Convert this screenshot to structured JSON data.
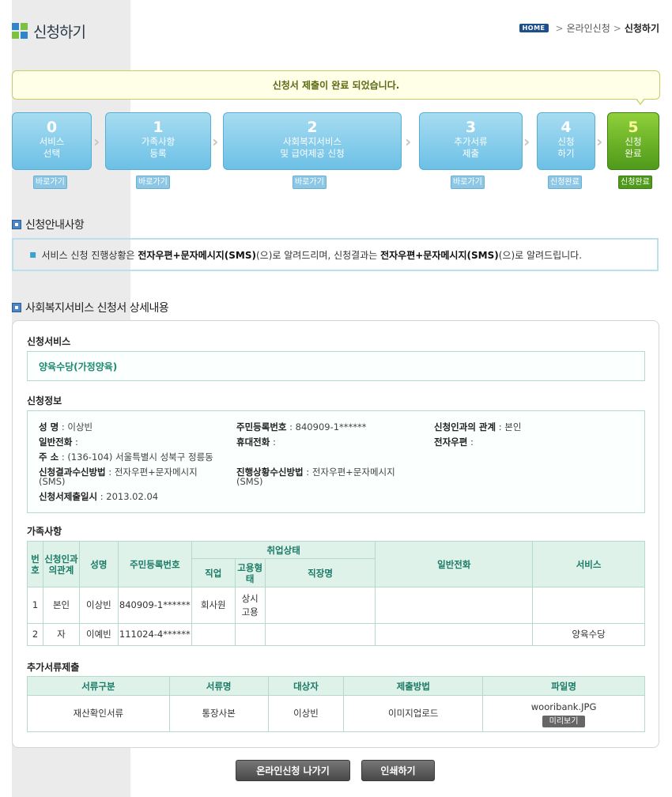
{
  "page": {
    "title": "신청하기"
  },
  "breadcrumb": {
    "home": "HOME",
    "items": [
      "온라인신청",
      "신청하기"
    ]
  },
  "notice": {
    "text": "신청서 제출이 완료 되었습니다."
  },
  "steps": [
    {
      "num": "0",
      "line1": "서비스",
      "line2": "선택",
      "badge": "바로가기"
    },
    {
      "num": "1",
      "line1": "가족사항",
      "line2": "등록",
      "badge": "바로가기"
    },
    {
      "num": "2",
      "line1": "사회복지서비스",
      "line2": "및 급여제공 신청",
      "badge": "바로가기"
    },
    {
      "num": "3",
      "line1": "추가서류",
      "line2": "제출",
      "badge": "바로가기"
    },
    {
      "num": "4",
      "line1": "신청",
      "line2": "하기",
      "badge": "신청완료"
    },
    {
      "num": "5",
      "line1": "신청",
      "line2": "완료",
      "badge": "신청완료"
    }
  ],
  "guide": {
    "heading": "신청안내사항",
    "text_a": "서비스 신청 진행상황은 ",
    "bold_a": "전자우편+문자메시지(SMS)",
    "text_b": "(으)로 알려드리며, 신청결과는 ",
    "bold_b": "전자우편+문자메시지(SMS)",
    "text_c": "(으)로 알려드립니다."
  },
  "detail": {
    "heading": "사회복지서비스 신청서 상세내용",
    "service_label": "신청서비스",
    "service_value": "양육수당(가정양육)",
    "info_label": "신청정보",
    "info": {
      "name_label": "성 명",
      "name": "이상빈",
      "rrn_label": "주민등록번호",
      "rrn": "840909-1******",
      "relation_label": "신청인과의 관계",
      "relation": "본인",
      "phone_label": "일반전화",
      "phone": "",
      "mobile_label": "휴대전화",
      "mobile": "",
      "email_label": "전자우편",
      "email": "",
      "address_label": "주 소",
      "address": "(136-104) 서울특별시 성북구 정릉동",
      "result_method_label": "신청결과수신방법",
      "result_method_1": "전자우편+문자메시지",
      "result_method_2": "(SMS)",
      "progress_method_label": "진행상황수신방법",
      "progress_method_1": "전자우편+문자메시지",
      "progress_method_2": "(SMS)",
      "submit_date_label": "신청서제출일시",
      "submit_date": "2013.02.04"
    },
    "family_label": "가족사항",
    "family_headers": {
      "no": "번호",
      "relation": "신청인과의관계",
      "name": "성명",
      "rrn": "주민등록번호",
      "employment": "취업상태",
      "job": "직업",
      "emp_type": "고용형태",
      "workplace": "직장명",
      "phone": "일반전화",
      "service": "서비스"
    },
    "family_rows": [
      {
        "no": "1",
        "relation": "본인",
        "name": "이상빈",
        "rrn": "840909-1******",
        "job": "회사원",
        "emp_type_1": "상시",
        "emp_type_2": "고용",
        "workplace": "",
        "phone": "",
        "service": ""
      },
      {
        "no": "2",
        "relation": "자",
        "name": "이예빈",
        "rrn": "111024-4******",
        "job": "",
        "emp_type_1": "",
        "emp_type_2": "",
        "workplace": "",
        "phone": "",
        "service": "양육수당"
      }
    ],
    "docs_label": "추가서류제출",
    "doc_headers": {
      "category": "서류구분",
      "name": "서류명",
      "target": "대상자",
      "method": "제출방법",
      "file": "파일명"
    },
    "doc_rows": [
      {
        "category": "재산확인서류",
        "name": "통장사본",
        "target": "이상빈",
        "method": "이미지업로드",
        "file": "wooribank.JPG",
        "preview": "미리보기"
      }
    ]
  },
  "buttons": {
    "exit": "온라인신청 나가기",
    "print": "인쇄하기"
  },
  "colors": {
    "step_blue": "#6cc0e6",
    "step_green": "#4e9a1a",
    "table_header": "#dff2ea",
    "accent_teal": "#1c8a70"
  }
}
